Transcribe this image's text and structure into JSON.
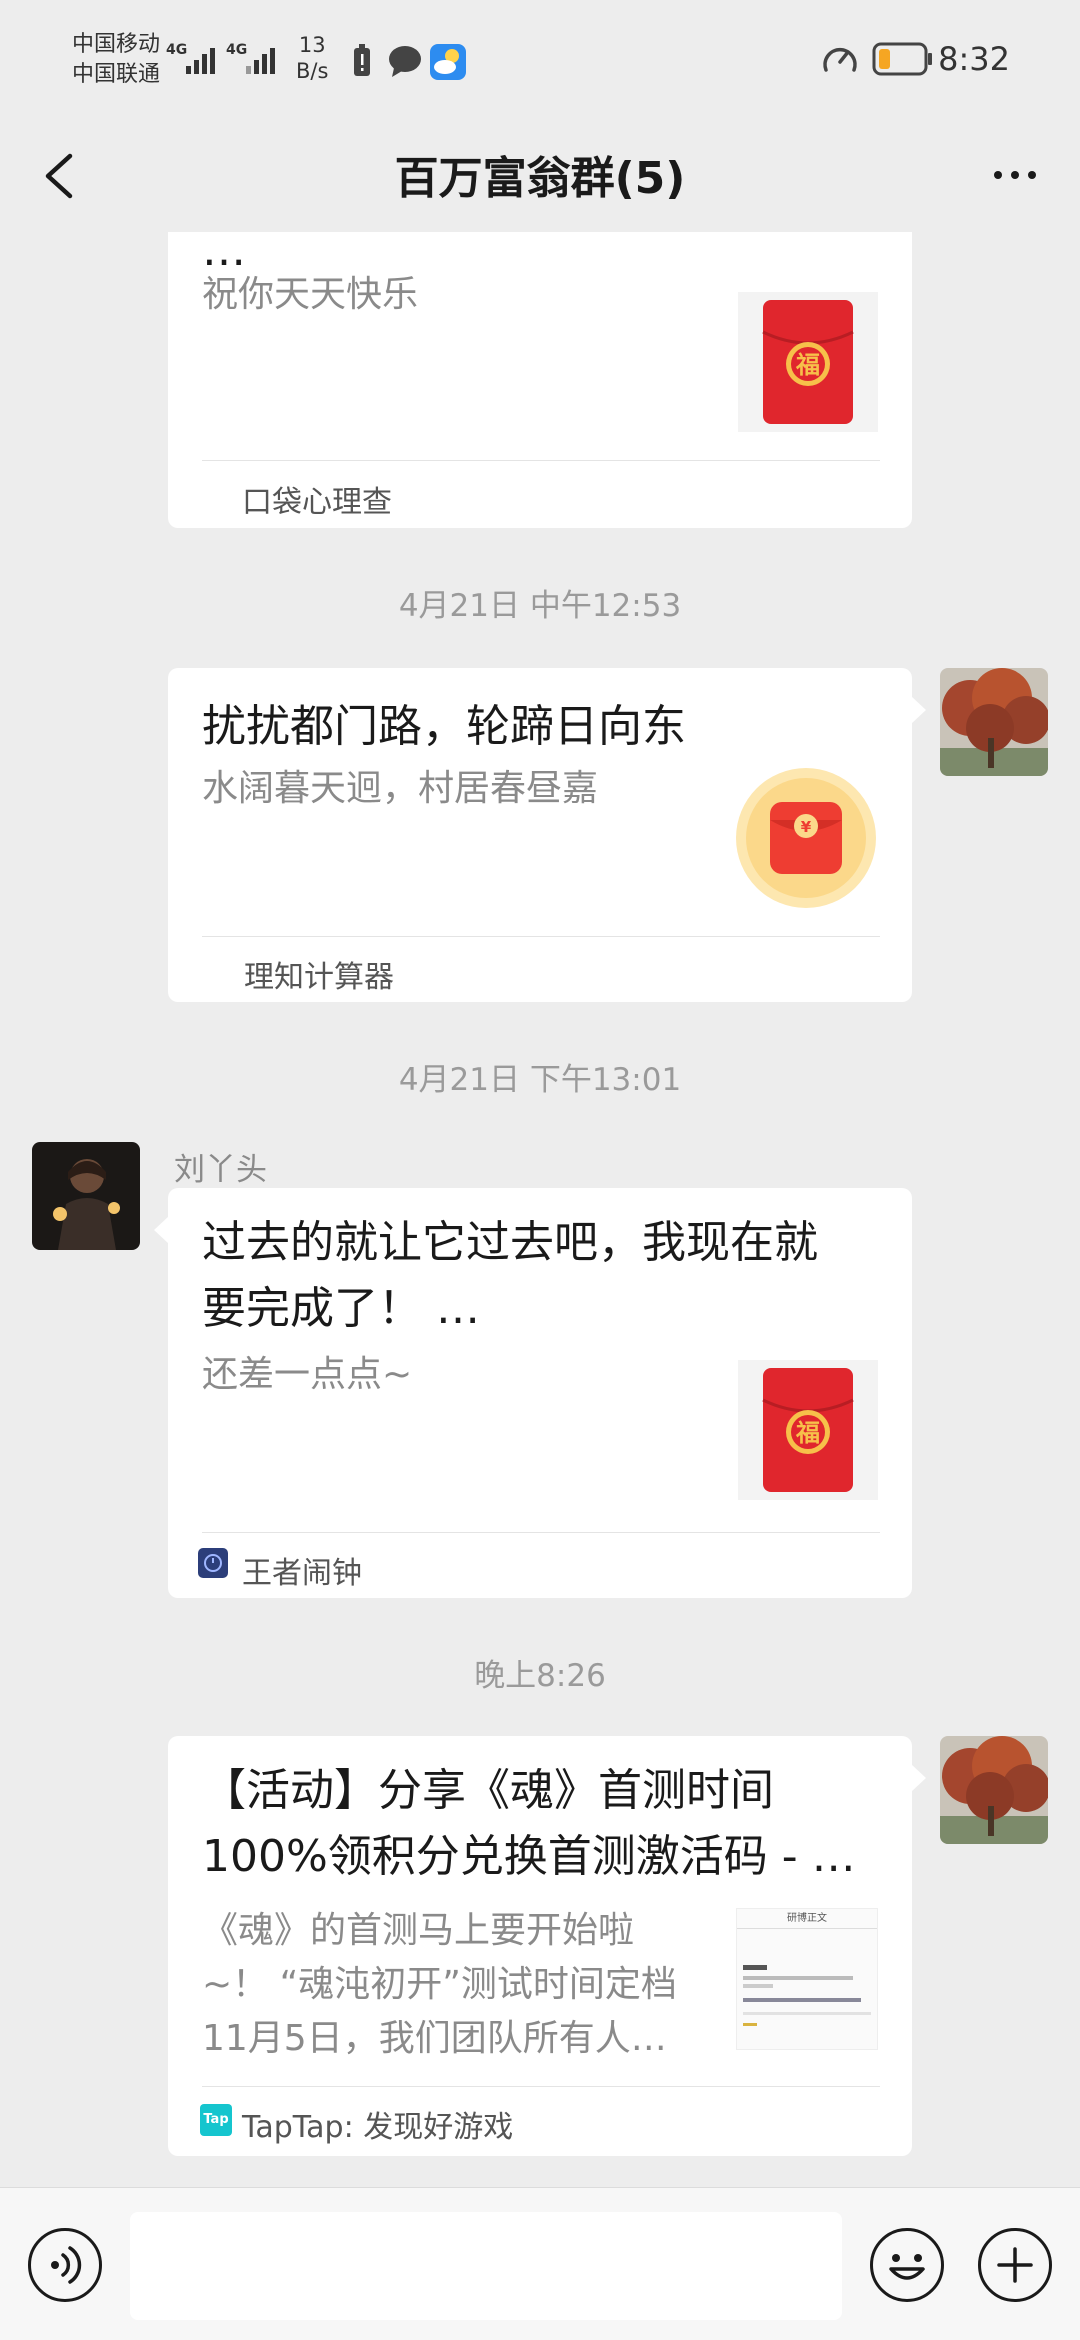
{
  "status_bar": {
    "carrier_1": "中国移动",
    "carrier_2": "中国联通",
    "signal_1_label": "4G",
    "signal_2_label": "4G",
    "net_speed_value": "13",
    "net_speed_unit": "B/s",
    "time": "8:32",
    "battery_level": 0.25,
    "battery_color": "#f5a623"
  },
  "header": {
    "title": "百万富翁群(5)",
    "back_icon": "chevron-left-icon",
    "more_icon": "more-dots-icon"
  },
  "messages": [
    {
      "type": "share_card",
      "title": "…",
      "description": "祝你天天快乐",
      "source": "口袋心理查",
      "thumb_icon": "red-envelope-fu-icon"
    },
    {
      "type": "timestamp",
      "text": "4月21日 中午12:53"
    },
    {
      "type": "share_card",
      "title": "扰扰都门路，轮蹄日向东",
      "description": "水阔暮天迥，村居春昼嘉",
      "source": "理知计算器",
      "thumb_icon": "red-envelope-yuan-icon"
    },
    {
      "type": "timestamp",
      "text": "4月21日 下午13:01"
    },
    {
      "type": "share_card",
      "sender": "刘丫头",
      "title_line_1": "过去的就让它过去吧，我现在就",
      "title_line_2": "要完成了！ …",
      "description": "还差一点点~",
      "source": "王者闹钟",
      "thumb_icon": "red-envelope-fu-icon"
    },
    {
      "type": "timestamp",
      "text": "晚上8:26"
    },
    {
      "type": "share_card",
      "title_line_1": "【活动】分享《魂》首测时间",
      "title_line_2": "100%领积分兑换首测激活码 - …",
      "description_line_1": "《魂》的首测马上要开始啦",
      "description_line_2": "~！ “魂沌初开”测试时间定档",
      "description_line_3": "11月5日，我们团队所有人…",
      "source_badge": "Tap",
      "source": "TapTap: 发现好游戏",
      "thumb_header": "研博正文"
    }
  ],
  "input_bar": {
    "voice_icon": "voice-icon",
    "emoji_icon": "emoji-icon",
    "plus_icon": "plus-icon",
    "input_placeholder": ""
  },
  "colors": {
    "background": "#ededed",
    "card": "#ffffff",
    "timestamp_text": "#9a9a9a",
    "envelope_red": "#e0262d",
    "envelope_gold": "#f7c04a"
  }
}
